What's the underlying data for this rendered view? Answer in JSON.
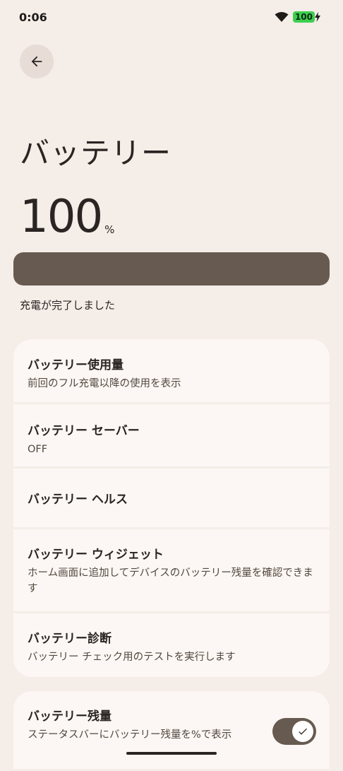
{
  "status_bar": {
    "time": "0:06",
    "battery_text": "100",
    "icons": [
      "wifi-icon",
      "battery-icon",
      "charging-bolt-icon"
    ]
  },
  "header": {
    "back_icon": "arrow-back-icon",
    "title": "バッテリー"
  },
  "battery": {
    "level": "100",
    "unit": "%",
    "level_fraction": 1.0,
    "status": "充電が完了しました"
  },
  "settings": [
    {
      "title": "バッテリー使用量",
      "subtitle": "前回のフル充電以降の使用を表示"
    },
    {
      "title": "バッテリー セーバー",
      "subtitle": "OFF"
    },
    {
      "title": "バッテリー ヘルス",
      "subtitle": ""
    },
    {
      "title": "バッテリー ウィジェット",
      "subtitle": "ホーム画面に追加してデバイスのバッテリー残量を確認できます"
    },
    {
      "title": "バッテリー診断",
      "subtitle": "バッテリー チェック用のテストを実行します"
    }
  ],
  "percentage_setting": {
    "title": "バッテリー残量",
    "subtitle": "ステータスバーにバッテリー残量を%で表示",
    "enabled": true
  },
  "colors": {
    "background": "#f4ede8",
    "card": "#fcf7f4",
    "accent": "#675a50",
    "battery_green": "#3ccf4e"
  }
}
